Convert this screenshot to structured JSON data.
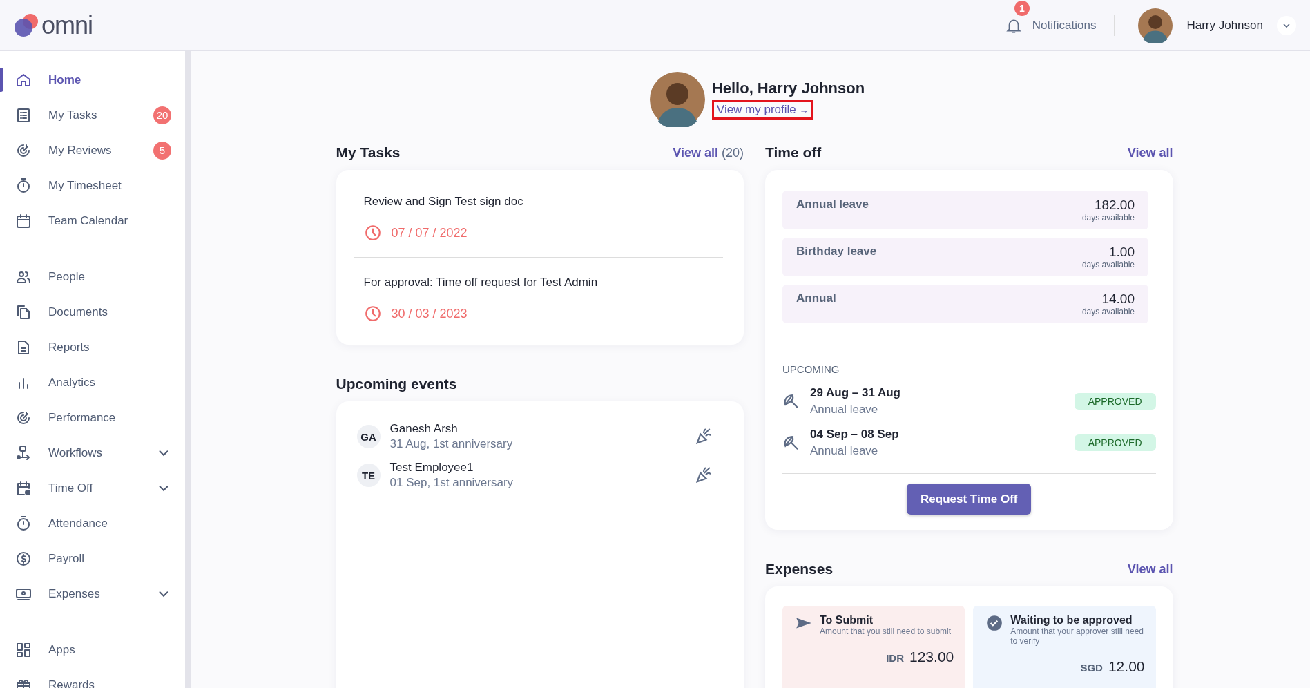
{
  "topbar": {
    "logo": "omni",
    "notifications": {
      "label": "Notifications",
      "count": "1"
    },
    "user": {
      "name": "Harry Johnson"
    }
  },
  "sidebar": {
    "sections": [
      {
        "items": [
          {
            "label": "Home",
            "selected": true,
            "kind": "link"
          },
          {
            "label": "My Tasks",
            "selected": false,
            "kind": "link",
            "badge": "20"
          },
          {
            "label": "My Reviews",
            "selected": false,
            "kind": "link",
            "badge": "5"
          },
          {
            "label": "My Timesheet",
            "selected": false,
            "kind": "link"
          },
          {
            "label": "Team Calendar",
            "selected": false,
            "kind": "link"
          }
        ]
      },
      {
        "items": [
          {
            "label": "People",
            "selected": false,
            "kind": "link"
          },
          {
            "label": "Documents",
            "selected": false,
            "kind": "link"
          },
          {
            "label": "Reports",
            "selected": false,
            "kind": "link"
          },
          {
            "label": "Analytics",
            "selected": false,
            "kind": "link"
          },
          {
            "label": "Performance",
            "selected": false,
            "kind": "link"
          },
          {
            "label": "Workflows",
            "selected": false,
            "kind": "group",
            "expanded": false
          },
          {
            "label": "Time Off",
            "selected": false,
            "kind": "group",
            "expanded": false
          },
          {
            "label": "Attendance",
            "selected": false,
            "kind": "link"
          },
          {
            "label": "Payroll",
            "selected": false,
            "kind": "link"
          },
          {
            "label": "Expenses",
            "selected": false,
            "kind": "group",
            "expanded": false
          }
        ]
      },
      {
        "items": [
          {
            "label": "Apps",
            "selected": false,
            "kind": "link"
          },
          {
            "label": "Rewards",
            "selected": false,
            "kind": "link"
          }
        ]
      }
    ]
  },
  "greeting": {
    "title": "Hello, Harry Johnson",
    "profile_link": "View my profile",
    "link_arrow": "→",
    "highlighted": true
  },
  "my_tasks": {
    "title": "My Tasks",
    "view_all": "View all",
    "count": "(20)",
    "tasks": [
      {
        "title": "Review and Sign Test sign doc",
        "date": "07 / 07 / 2022"
      },
      {
        "title": "For approval: Time off request for Test Admin",
        "date": "30 / 03 / 2023"
      }
    ]
  },
  "upcoming_events": {
    "title": "Upcoming events",
    "events": [
      {
        "initials": "GA",
        "name": "Ganesh Arsh",
        "detail": "31 Aug, 1st anniversary"
      },
      {
        "initials": "TE",
        "name": "Test Employee1",
        "detail": "01 Sep, 1st anniversary"
      }
    ]
  },
  "time_off": {
    "title": "Time off",
    "view_all": "View all",
    "balances": [
      {
        "name": "Annual leave",
        "value": "182.00",
        "unit": "days available"
      },
      {
        "name": "Birthday leave",
        "value": "1.00",
        "unit": "days available"
      },
      {
        "name": "Annual",
        "value": "14.00",
        "unit": "days available"
      }
    ],
    "upcoming_label": "UPCOMING",
    "upcoming": [
      {
        "dates": "29 Aug – 31 Aug",
        "type": "Annual leave",
        "status": "APPROVED"
      },
      {
        "dates": "04 Sep – 08 Sep",
        "type": "Annual leave",
        "status": "APPROVED"
      }
    ],
    "button": "Request Time Off"
  },
  "expenses": {
    "title": "Expenses",
    "view_all": "View all",
    "cards": [
      {
        "title": "To Submit",
        "subtitle": "Amount that you still need to submit",
        "currency": "IDR",
        "amount": "123.00",
        "color": "#fbeeee"
      },
      {
        "title": "Waiting to be approved",
        "subtitle": "Amount that your approver still need to verify",
        "currency": "SGD",
        "amount": "12.00",
        "color": "#eff5fd"
      }
    ]
  }
}
